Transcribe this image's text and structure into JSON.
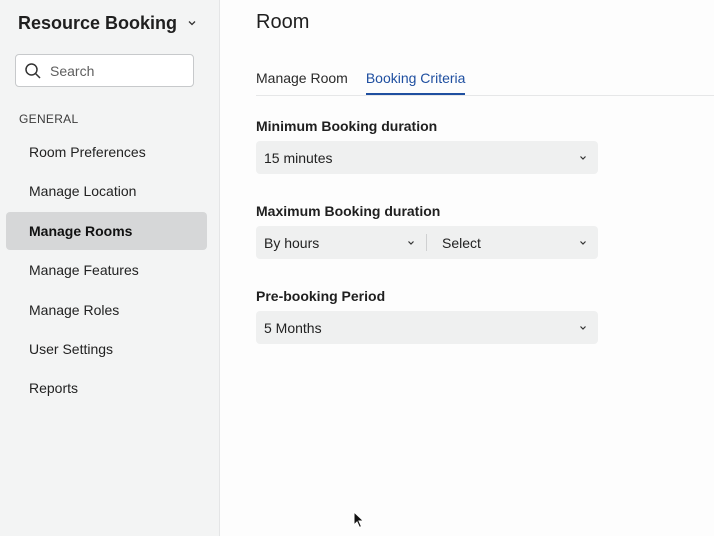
{
  "app": {
    "title": "Resource Booking"
  },
  "search": {
    "placeholder": "Search"
  },
  "sidebar": {
    "section": "GENERAL",
    "items": [
      {
        "label": "Room Preferences"
      },
      {
        "label": "Manage Location"
      },
      {
        "label": "Manage Rooms"
      },
      {
        "label": "Manage Features"
      },
      {
        "label": "Manage Roles"
      },
      {
        "label": "User Settings"
      },
      {
        "label": "Reports"
      }
    ]
  },
  "main": {
    "title": "Room",
    "tabs": [
      {
        "label": "Manage Room"
      },
      {
        "label": "Booking Criteria"
      }
    ],
    "fields": {
      "min_duration": {
        "label": "Minimum Booking duration",
        "value": "15 minutes"
      },
      "max_duration": {
        "label": "Maximum Booking duration",
        "unit_value": "By hours",
        "amount_value": "Select"
      },
      "pre_booking": {
        "label": "Pre-booking Period",
        "value": "5 Months"
      }
    }
  },
  "colors": {
    "accent": "#1f4fa0",
    "sidebar_bg": "#f3f4f4",
    "active_item_bg": "#d6d7d8",
    "select_bg": "#eff0f0"
  }
}
